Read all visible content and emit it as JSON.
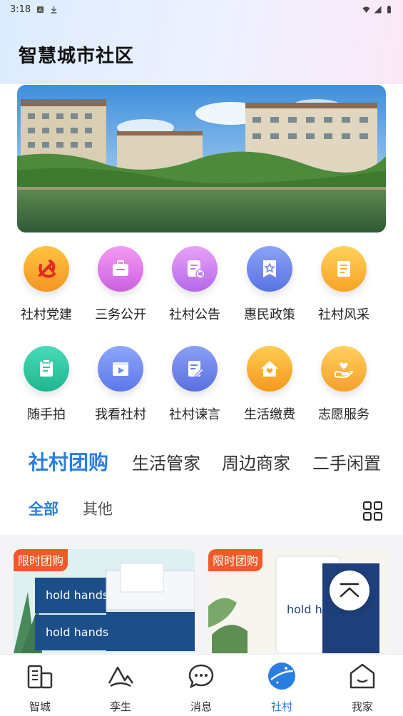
{
  "status_bar": {
    "time": "3:18"
  },
  "header": {
    "title": "智慧城市社区"
  },
  "services": [
    {
      "label": "社村党建",
      "icon": "party-emblem-icon",
      "color": "#f7a32a"
    },
    {
      "label": "三务公开",
      "icon": "briefcase-icon",
      "color": "#d66ee6"
    },
    {
      "label": "社村公告",
      "icon": "announcement-icon",
      "color": "#c77cf0"
    },
    {
      "label": "惠民政策",
      "icon": "policy-star-icon",
      "color": "#6a86ec"
    },
    {
      "label": "社村风采",
      "icon": "document-icon",
      "color": "#f8b532"
    },
    {
      "label": "随手拍",
      "icon": "clipboard-icon",
      "color": "#2ec6a2"
    },
    {
      "label": "我看社村",
      "icon": "video-icon",
      "color": "#6d8cf0"
    },
    {
      "label": "社村谏言",
      "icon": "edit-note-icon",
      "color": "#6680ec"
    },
    {
      "label": "生活缴费",
      "icon": "home-heart-icon",
      "color": "#f7a82c"
    },
    {
      "label": "志愿服务",
      "icon": "hand-heart-icon",
      "color": "#f6ac36"
    }
  ],
  "main_tabs": [
    "社村团购",
    "生活管家",
    "周边商家",
    "二手闲置"
  ],
  "sub_tabs": [
    "全部",
    "其他"
  ],
  "products": [
    {
      "badge": "限时团购"
    },
    {
      "badge": "限时团购"
    }
  ],
  "bottom_nav": [
    {
      "label": "智城",
      "icon": "city-building-icon"
    },
    {
      "label": "孪生",
      "icon": "twin-mountain-icon"
    },
    {
      "label": "消息",
      "icon": "chat-bubble-icon"
    },
    {
      "label": "社村",
      "icon": "planet-icon",
      "active": true
    },
    {
      "label": "我家",
      "icon": "home-icon"
    }
  ],
  "colors": {
    "accent": "#2a7de1",
    "promo": "#f05a28"
  }
}
